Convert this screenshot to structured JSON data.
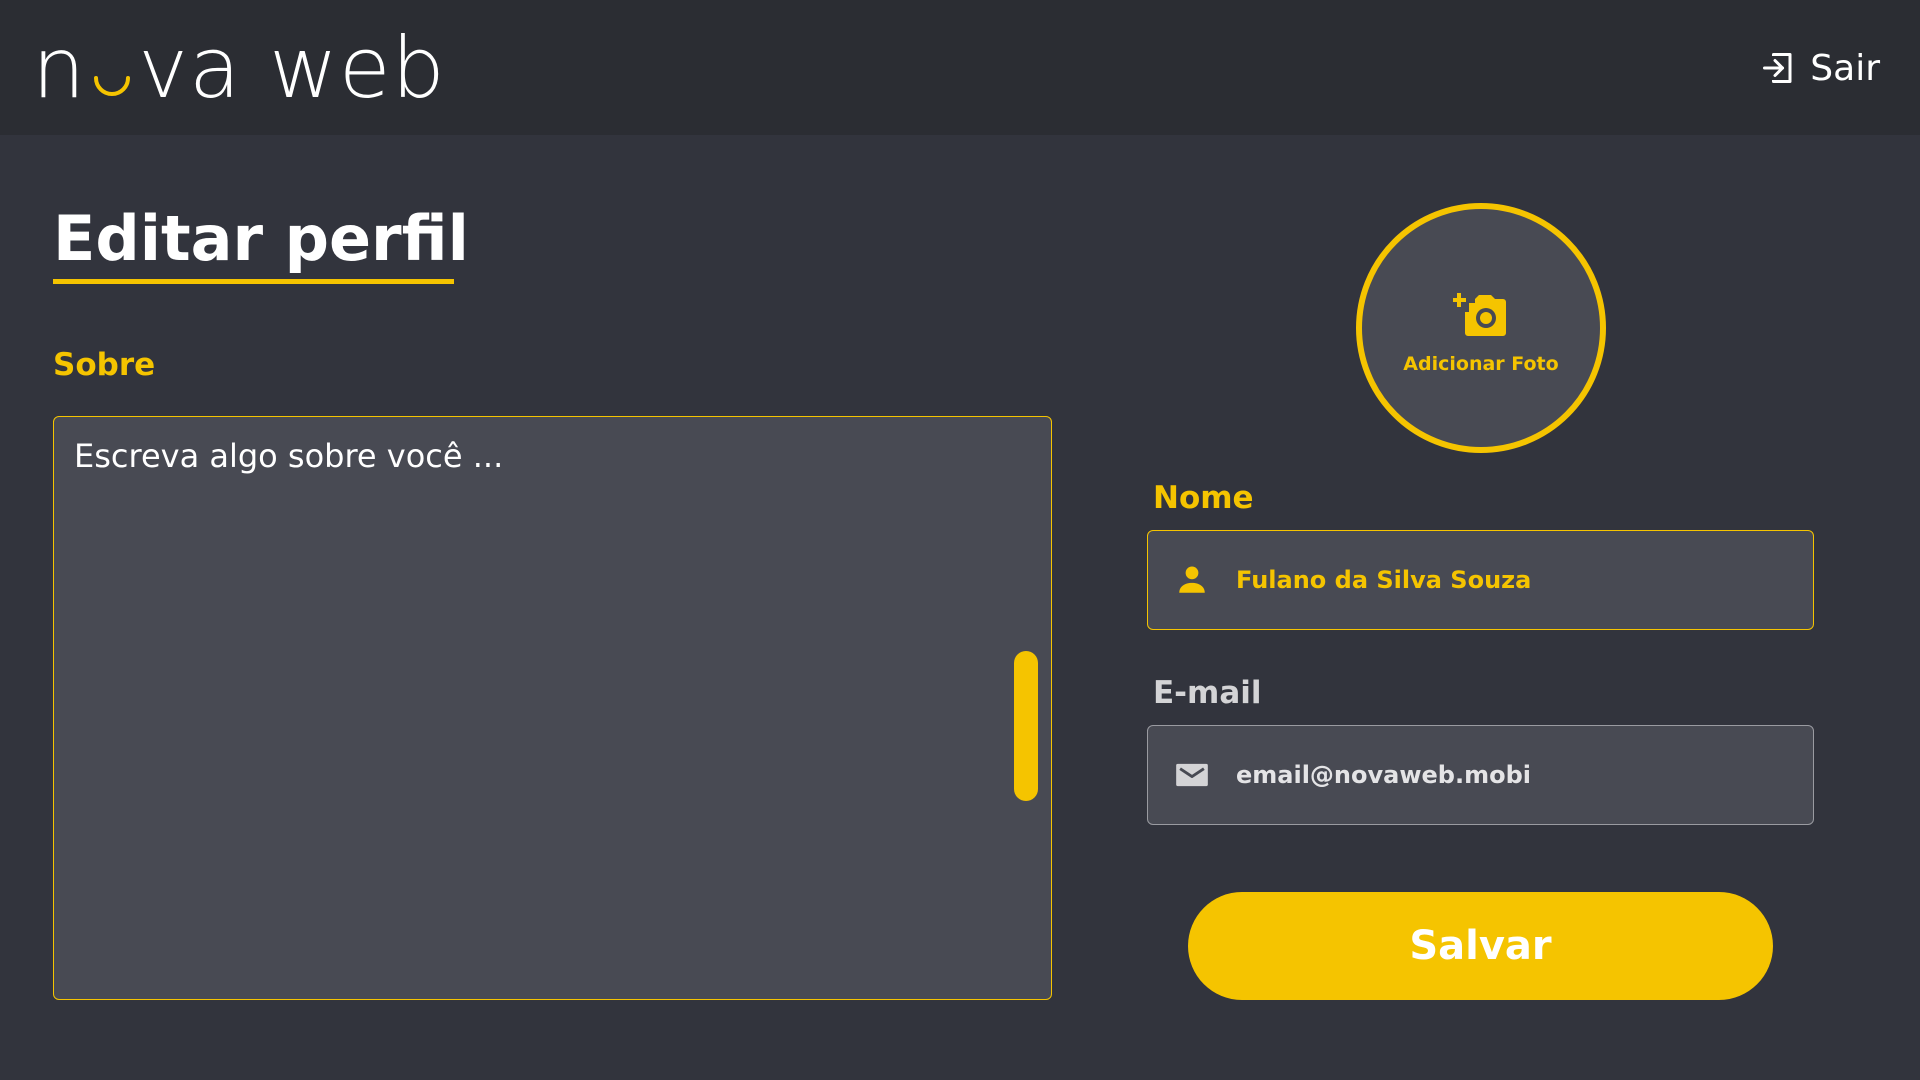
{
  "header": {
    "logo": {
      "part1": "n",
      "part2": "va web"
    },
    "logout_label": "Sair",
    "logout_icon": "logout-icon"
  },
  "page": {
    "title": "Editar perfil"
  },
  "about": {
    "label": "Sobre",
    "placeholder": "Escreva algo sobre você ...",
    "value": ""
  },
  "avatar": {
    "label": "Adicionar Foto",
    "icon": "add-photo-icon"
  },
  "name_field": {
    "label": "Nome",
    "value": "Fulano da Silva Souza",
    "icon": "person-icon"
  },
  "email_field": {
    "label": "E-mail",
    "value": "email@novaweb.mobi",
    "icon": "mail-icon"
  },
  "save_label": "Salvar",
  "colors": {
    "accent": "#f5c400",
    "header_bg": "#2b2d33",
    "page_bg": "#32343d",
    "field_bg": "#484a53"
  }
}
